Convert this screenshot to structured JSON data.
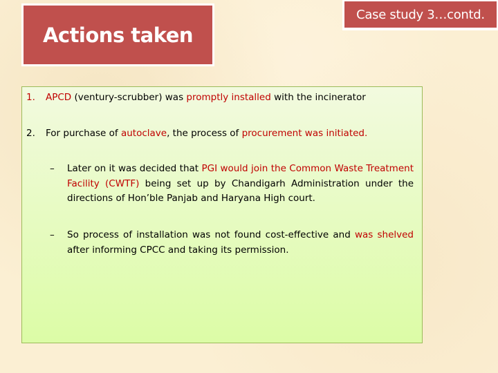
{
  "title": "Actions taken",
  "subtitle": "Case study 3…contd.",
  "colors": {
    "header_fill": "#c0504d",
    "highlight_text": "#c00000",
    "content_border": "#9bbb59",
    "content_fill_top": "#f2fadf",
    "content_fill_bottom": "#dcfca6",
    "background": "#fbefd3"
  },
  "items": [
    {
      "number": "1.",
      "segments": [
        {
          "text": "APCD",
          "highlight": true
        },
        {
          "text": " (ventury-scrubber) was ",
          "highlight": false
        },
        {
          "text": "promptly installed",
          "highlight": true
        },
        {
          "text": " with the incinerator",
          "highlight": false
        }
      ]
    },
    {
      "number": "2.",
      "segments": [
        {
          "text": "For purchase of ",
          "highlight": false
        },
        {
          "text": "autoclave",
          "highlight": true
        },
        {
          "text": ", the process of ",
          "highlight": false
        },
        {
          "text": "procurement was initiated.",
          "highlight": true
        }
      ],
      "subitems": [
        {
          "bullet": "–",
          "segments": [
            {
              "text": "Later on it was decided that ",
              "highlight": false
            },
            {
              "text": "PGI would join the Common Waste Treatment Facility (CWTF)",
              "highlight": true
            },
            {
              "text": " being set up by Chandigarh Administration under the directions of Hon’ble Panjab and Haryana High court.",
              "highlight": false
            }
          ]
        },
        {
          "bullet": "–",
          "segments": [
            {
              "text": "So process of installation was not found cost-effective and ",
              "highlight": false
            },
            {
              "text": "was shelved",
              "highlight": true
            },
            {
              "text": " after informing CPCC and taking its permission.",
              "highlight": false
            }
          ]
        }
      ]
    }
  ]
}
